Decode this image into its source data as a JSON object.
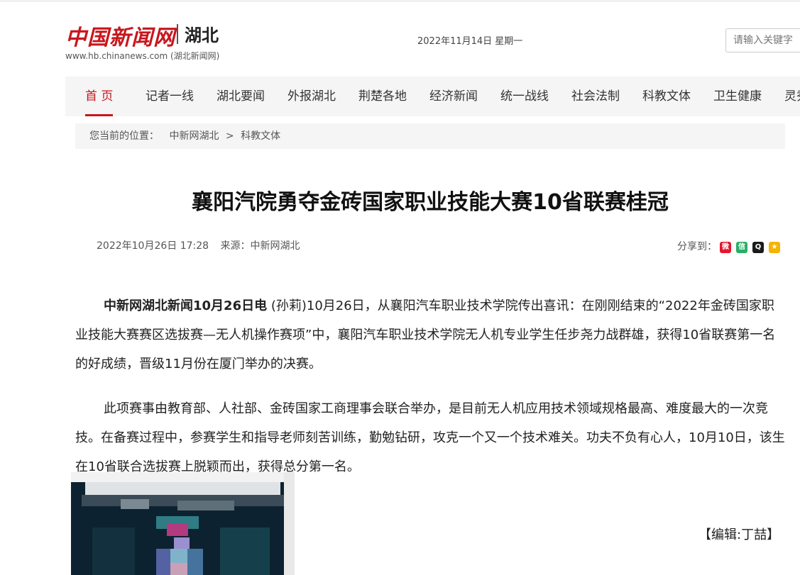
{
  "header": {
    "logo_cn": "中国新闻网",
    "logo_region": "湖北",
    "logo_url": "www.hb.chinanews.com (湖北新闻网)",
    "date": "2022年11月14日 星期一",
    "search_placeholder": "请输入关键字"
  },
  "nav": {
    "items": [
      {
        "label": "首 页",
        "active": true
      },
      {
        "label": "记者一线"
      },
      {
        "label": "湖北要闻"
      },
      {
        "label": "外报湖北"
      },
      {
        "label": "荆楚各地"
      },
      {
        "label": "经济新闻"
      },
      {
        "label": "统一战线"
      },
      {
        "label": "社会法制"
      },
      {
        "label": "科教文体"
      },
      {
        "label": "卫生健康"
      },
      {
        "label": "灵秀"
      }
    ]
  },
  "breadcrumb": {
    "prefix": "您当前的位置：",
    "home": "中新网湖北",
    "separator": ">",
    "current": "科教文体"
  },
  "article": {
    "title": "襄阳汽院勇夺金砖国家职业技能大赛10省联赛桂冠",
    "datetime": "2022年10月26日 17:28",
    "source": "来源：中新网湖北",
    "share_label": "分享到：",
    "share_icons": [
      {
        "name": "weibo-icon",
        "color": "#e6162d",
        "glyph": "微"
      },
      {
        "name": "wechat-icon",
        "color": "#2aae67",
        "glyph": "信"
      },
      {
        "name": "qq-icon",
        "color": "#1a1a1a",
        "glyph": "Q"
      },
      {
        "name": "qzone-icon",
        "color": "#f5b400",
        "glyph": "★"
      }
    ],
    "lead_bold": "中新网湖北新闻10月26日电",
    "paragraph1": " (孙莉)10月26日，从襄阳汽车职业技术学院传出喜讯：在刚刚结束的“2022年金砖国家职业技能大赛赛区选拔赛—无人机操作赛项”中，襄阳汽车职业技术学院无人机专业学生任步尧力战群雄，获得10省联赛第一名的好成绩，晋级11月份在厦门举办的决赛。",
    "paragraph2": "此项赛事由教育部、人社部、金砖国家工商理事会联合举办，是目前无人机应用技术领域规格最高、难度最大的一次竞技。在备赛过程中，参赛学生和指导老师刻苦训练，勤勉钻研，攻克一个又一个技术难关。功夫不负有心人，10月10日，该生在10省联合选拔赛上脱颖而出，获得总分第一名。",
    "editor": "【编辑:丁喆】"
  },
  "colors": {
    "brand_red": "#c8161d",
    "nav_bg": "#f5f5f5"
  }
}
